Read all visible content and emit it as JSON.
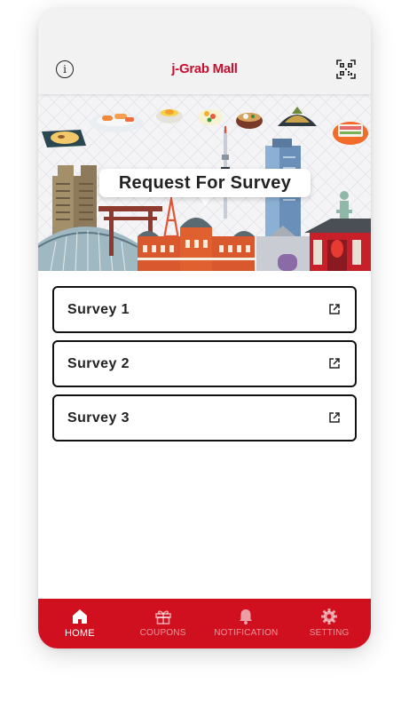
{
  "header": {
    "title": "j-Grab Mall",
    "info_icon": "info-icon",
    "qr_icon": "qr-code-icon"
  },
  "banner": {
    "label": "Request For Survey"
  },
  "surveys": [
    {
      "label": "Survey 1",
      "icon": "external-link-icon"
    },
    {
      "label": "Survey 2",
      "icon": "external-link-icon"
    },
    {
      "label": "Survey 3",
      "icon": "external-link-icon"
    }
  ],
  "tabbar": {
    "tabs": [
      {
        "label": "HOME",
        "icon": "home-icon",
        "active": true
      },
      {
        "label": "COUPONS",
        "icon": "gift-icon",
        "active": false
      },
      {
        "label": "NOTIFICATION",
        "icon": "bell-icon",
        "active": false
      },
      {
        "label": "SETTING",
        "icon": "gear-icon",
        "active": false
      }
    ]
  },
  "colors": {
    "brand": "#c8102e",
    "tabbar": "#d0101e",
    "header_bg": "#f2f2f2"
  }
}
